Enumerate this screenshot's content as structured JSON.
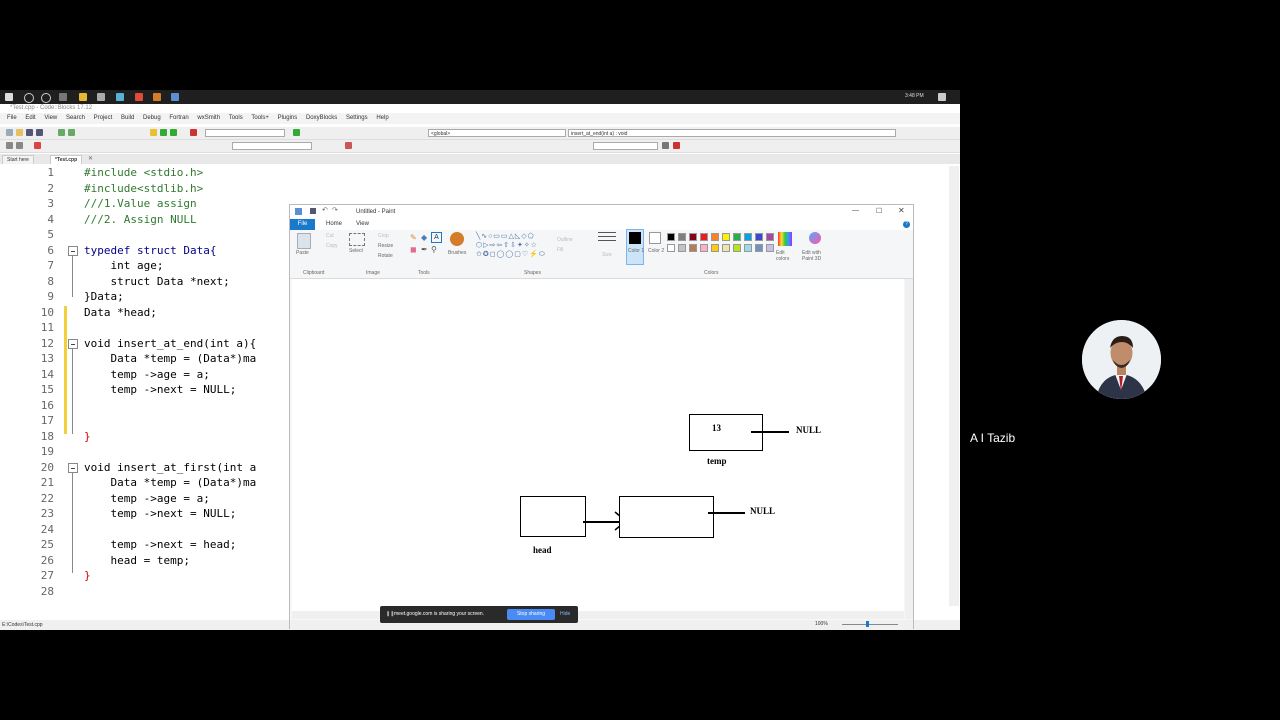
{
  "taskbar": {
    "time": "3:48 PM"
  },
  "codeblocks": {
    "title": "*Test.cpp - Code::Blocks 17.12",
    "menu": [
      "File",
      "Edit",
      "View",
      "Search",
      "Project",
      "Build",
      "Debug",
      "Fortran",
      "wxSmith",
      "Tools",
      "Tools+",
      "Plugins",
      "DoxyBlocks",
      "Settings",
      "Help"
    ],
    "scope_combo": "<global>",
    "function_combo": "insert_at_end(int a) : void",
    "tabs": [
      "Start here",
      "*Test.cpp"
    ],
    "status_path": "E:\\Codes\\Test.cpp",
    "lines": [
      {
        "n": "1",
        "text": "#include <stdio.h>"
      },
      {
        "n": "2",
        "text": "#include<stdlib.h>"
      },
      {
        "n": "3",
        "text": "///1.Value assign"
      },
      {
        "n": "4",
        "text": "///2. Assign NULL"
      },
      {
        "n": "5",
        "text": ""
      },
      {
        "n": "6",
        "text": "typedef struct Data{"
      },
      {
        "n": "7",
        "text": "    int age;"
      },
      {
        "n": "8",
        "text": "    struct Data *next;"
      },
      {
        "n": "9",
        "text": "}Data;"
      },
      {
        "n": "10",
        "text": "Data *head;"
      },
      {
        "n": "11",
        "text": ""
      },
      {
        "n": "12",
        "text": "void insert_at_end(int a){"
      },
      {
        "n": "13",
        "text": "    Data *temp = (Data*)ma"
      },
      {
        "n": "14",
        "text": "    temp ->age = a;"
      },
      {
        "n": "15",
        "text": "    temp ->next = NULL;"
      },
      {
        "n": "16",
        "text": ""
      },
      {
        "n": "17",
        "text": ""
      },
      {
        "n": "18",
        "text": "}"
      },
      {
        "n": "19",
        "text": ""
      },
      {
        "n": "20",
        "text": "void insert_at_first(int a"
      },
      {
        "n": "21",
        "text": "    Data *temp = (Data*)ma"
      },
      {
        "n": "22",
        "text": "    temp ->age = a;"
      },
      {
        "n": "23",
        "text": "    temp ->next = NULL;"
      },
      {
        "n": "24",
        "text": ""
      },
      {
        "n": "25",
        "text": "    temp ->next = head;"
      },
      {
        "n": "26",
        "text": "    head = temp;"
      },
      {
        "n": "27",
        "text": "}"
      },
      {
        "n": "28",
        "text": ""
      }
    ]
  },
  "paint": {
    "title": "Untitled - Paint",
    "tabs": {
      "file": "File",
      "home": "Home",
      "view": "View"
    },
    "ribbon": {
      "paste": "Paste",
      "cut": "Cut",
      "copy": "Copy",
      "select": "Select",
      "crop": "Crop",
      "resize": "Resize",
      "rotate": "Rotate",
      "brushes": "Brushes",
      "outline": "Outline",
      "fill": "Fill",
      "size": "Size",
      "color1": "Color 1",
      "color2": "Color 2",
      "edit_colors": "Edit colors",
      "edit_paint3d": "Edit with Paint 3D",
      "groups": {
        "clipboard": "Clipboard",
        "image": "Image",
        "tools": "Tools",
        "shapes": "Shapes",
        "colors": "Colors"
      }
    },
    "palette": [
      "#000000",
      "#7f7f7f",
      "#880015",
      "#ed1c24",
      "#ff7f27",
      "#fff200",
      "#22b14c",
      "#00a2e8",
      "#3f48cc",
      "#a349a4",
      "#ffffff",
      "#c3c3c3",
      "#b97a57",
      "#ffaec9",
      "#ffc90e",
      "#efe4b0",
      "#b5e61d",
      "#99d9ea",
      "#7092be",
      "#c8bfe7"
    ],
    "drawing": {
      "temp_value": "13",
      "temp_null": "NULL",
      "temp_label": "temp",
      "list_null": "NULL",
      "head_label": "head"
    },
    "zoom": "100%"
  },
  "share_bar": {
    "message": "meet.google.com is sharing your screen.",
    "stop": "Stop sharing",
    "hide": "Hide"
  },
  "participant": {
    "name": "A I Tazib"
  }
}
